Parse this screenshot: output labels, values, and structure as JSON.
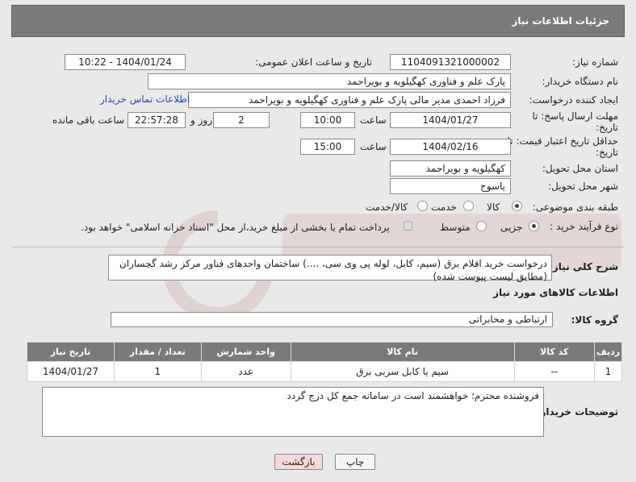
{
  "header": {
    "title": "جزئیات اطلاعات نیاز"
  },
  "fields": {
    "need_number_label": "شماره نیاز:",
    "need_number": "1104091321000002",
    "announce_label": "تاریخ و ساعت اعلان عمومی:",
    "announce_value": "1404/01/24 - 10:22",
    "buyer_org_label": "نام دستگاه خریدار:",
    "buyer_org": "پارک علم و فناوری کهگیلویه و بویراحمد",
    "creator_label": "ایجاد کننده درخواست:",
    "creator": "فرزاد احمدی مدیر مالی پارک علم و فناوری کهگیلویه و بویراحمد",
    "contact_link": "اطلاعات تماس خریدار",
    "deadline_label": "مهلت ارسال پاسخ: تا تاریخ:",
    "deadline_date": "1404/01/27",
    "time_label": "ساعت",
    "deadline_time": "10:00",
    "days_value": "2",
    "days_label": "روز و",
    "remaining_time": "22:57:28",
    "remaining_label": "ساعت باقی مانده",
    "min_validity_label": "حداقل تاریخ اعتبار قیمت: تا تاریخ:",
    "validity_date": "1404/02/16",
    "validity_time": "15:00",
    "province_label": "استان محل تحویل:",
    "province": "کهگیلویه و بویراحمد",
    "city_label": "شهر محل تحویل:",
    "city": "یاسوج",
    "category_label": "طبقه بندی موضوعی:",
    "category_options": [
      "کالا",
      "خدمت",
      "کالا/خدمت"
    ],
    "process_label": "نوع فرآیند خرید :",
    "process_options": [
      "جزیی",
      "متوسط"
    ],
    "payment_note": "پرداخت تمام یا بخشی از مبلغ خرید،از محل \"اسناد خزانه اسلامی\" خواهد بود.",
    "description_label": "شرح کلی نیاز:",
    "description": "درخواست خرید اقلام برق (سیم، کابل، لوله پی وی سی، ....) ساختمان واحدهای فناور مرکز رشد گچساران (مطابق لیست پیوست شده)",
    "goods_info_title": "اطلاعات کالاهای مورد نیاز",
    "goods_group_label": "گروه کالا:",
    "goods_group": "ارتباطی و مخابراتی"
  },
  "table": {
    "headers": [
      "ردیف",
      "کد کالا",
      "نام کالا",
      "واحد شمارش",
      "تعداد / مقدار",
      "تاریخ نیاز"
    ],
    "rows": [
      [
        "1",
        "--",
        "سیم یا کابل سربی برق",
        "عدد",
        "1",
        "1404/01/27"
      ]
    ]
  },
  "buyer_notes_label": "توضیحات خریدار:",
  "buyer_notes": "فروشنده محترم؛ خواهشمند است در سامانه جمع کل درج گردد",
  "buttons": {
    "print": "چاپ",
    "back": "بازگشت"
  },
  "colors": {
    "header_bg": "#7a7a7a",
    "link": "#1a4fb0",
    "back_button_bg": "#f7d9d9"
  }
}
